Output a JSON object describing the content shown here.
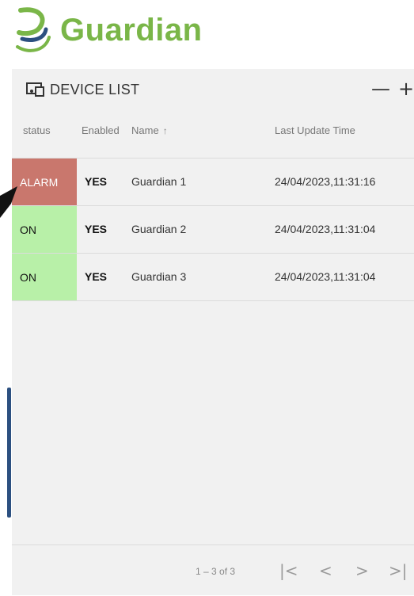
{
  "brand": {
    "name": "Guardian",
    "color": "#7ab648",
    "logo_accent": "#2c5080"
  },
  "panel": {
    "title": "DEVICE LIST",
    "icon": "device-icon",
    "actions": {
      "collapse_label": "—",
      "add_label": "+"
    }
  },
  "table": {
    "columns": [
      {
        "label": "status"
      },
      {
        "label": "Enabled"
      },
      {
        "label": "Name",
        "sorted": "ascending"
      },
      {
        "label": "Last Update Time"
      }
    ],
    "sort_arrow": "↑",
    "rows": [
      {
        "status": "ALARM",
        "status_color": "#c9776d",
        "enabled": "YES",
        "name": "Guardian 1",
        "time": "24/04/2023,11:31:16"
      },
      {
        "status": "ON",
        "status_color": "#b8f0a8",
        "enabled": "YES",
        "name": "Guardian 2",
        "time": "24/04/2023,11:31:04"
      },
      {
        "status": "ON",
        "status_color": "#b8f0a8",
        "enabled": "YES",
        "name": "Guardian 3",
        "time": "24/04/2023,11:31:04"
      }
    ]
  },
  "pagination": {
    "range": "1 – 3 of 3",
    "first": "|<",
    "prev": "<",
    "next": ">",
    "last": ">|"
  }
}
